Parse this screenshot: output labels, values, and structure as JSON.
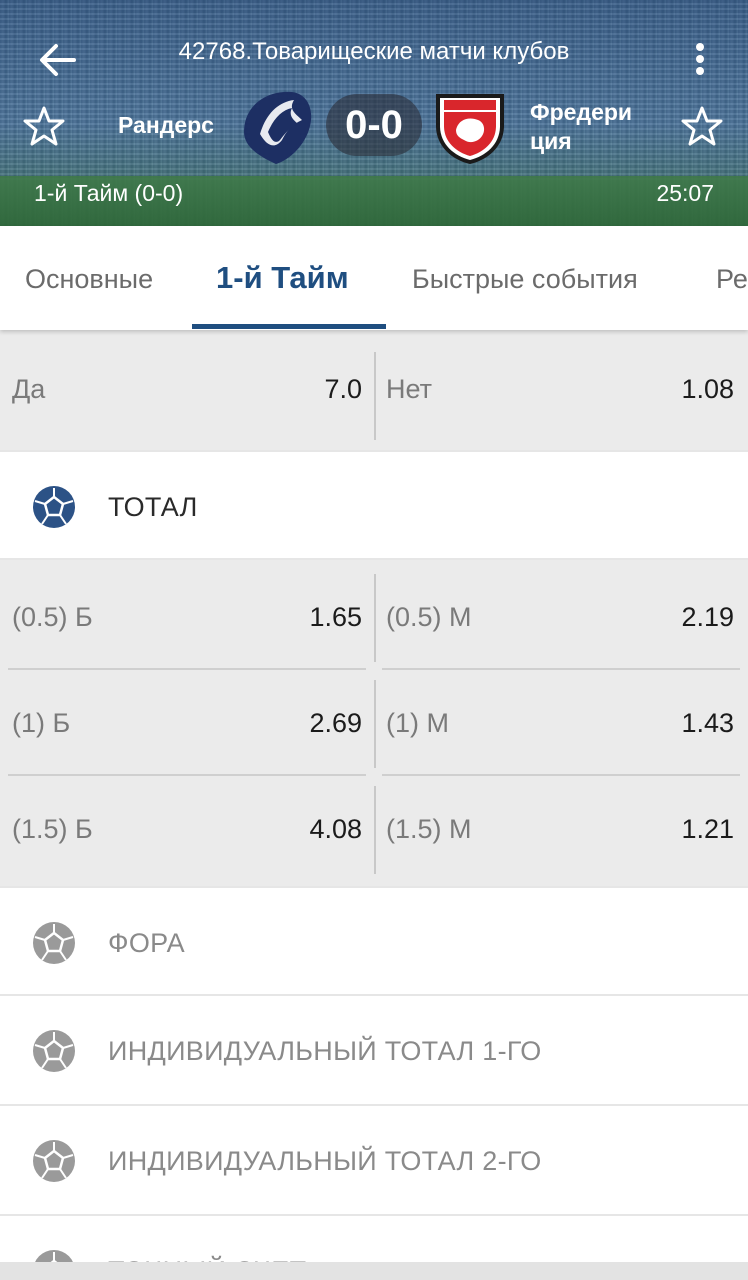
{
  "header": {
    "title": "42768.Товарищеские матчи клубов",
    "team_home": "Рандерс",
    "team_away_line1": "Фредери",
    "team_away_line2": "ция",
    "score": "0-0",
    "period": "1-й  Тайм (0-0)",
    "timer": "25:07",
    "icons": {
      "back": "arrow-left-icon",
      "menu": "more-vertical-icon",
      "favorite": "star-outline-icon"
    }
  },
  "tabs": [
    {
      "label": "Основные"
    },
    {
      "label": "1-й  Тайм"
    },
    {
      "label": "Быстрые события"
    },
    {
      "label": "Ре"
    }
  ],
  "active_tab": "1-й  Тайм",
  "yes_no": {
    "yes_label": "Да",
    "yes_odd": "7.0",
    "no_label": "Нет",
    "no_odd": "1.08"
  },
  "total": {
    "title": "ТОТАЛ",
    "rows": [
      {
        "over_label": "(0.5) Б",
        "over_odd": "1.65",
        "under_label": "(0.5) М",
        "under_odd": "2.19"
      },
      {
        "over_label": "(1) Б",
        "over_odd": "2.69",
        "under_label": "(1) М",
        "under_odd": "1.43"
      },
      {
        "over_label": "(1.5) Б",
        "over_odd": "4.08",
        "under_label": "(1.5) М",
        "under_odd": "1.21"
      }
    ]
  },
  "sections": [
    {
      "title": "ФОРА"
    },
    {
      "title": "ИНДИВИДУАЛЬНЫЙ ТОТАЛ 1-ГО"
    },
    {
      "title": "ИНДИВИДУАЛЬНЫЙ ТОТАЛ 2-ГО"
    },
    {
      "title": "ТОЧНЫЙ СЧЕТ"
    }
  ],
  "colors": {
    "accent": "#1f4e80",
    "cell_bg": "#ebebeb",
    "ball_active": "#2c5286",
    "ball_inactive": "#9a9a9a"
  }
}
